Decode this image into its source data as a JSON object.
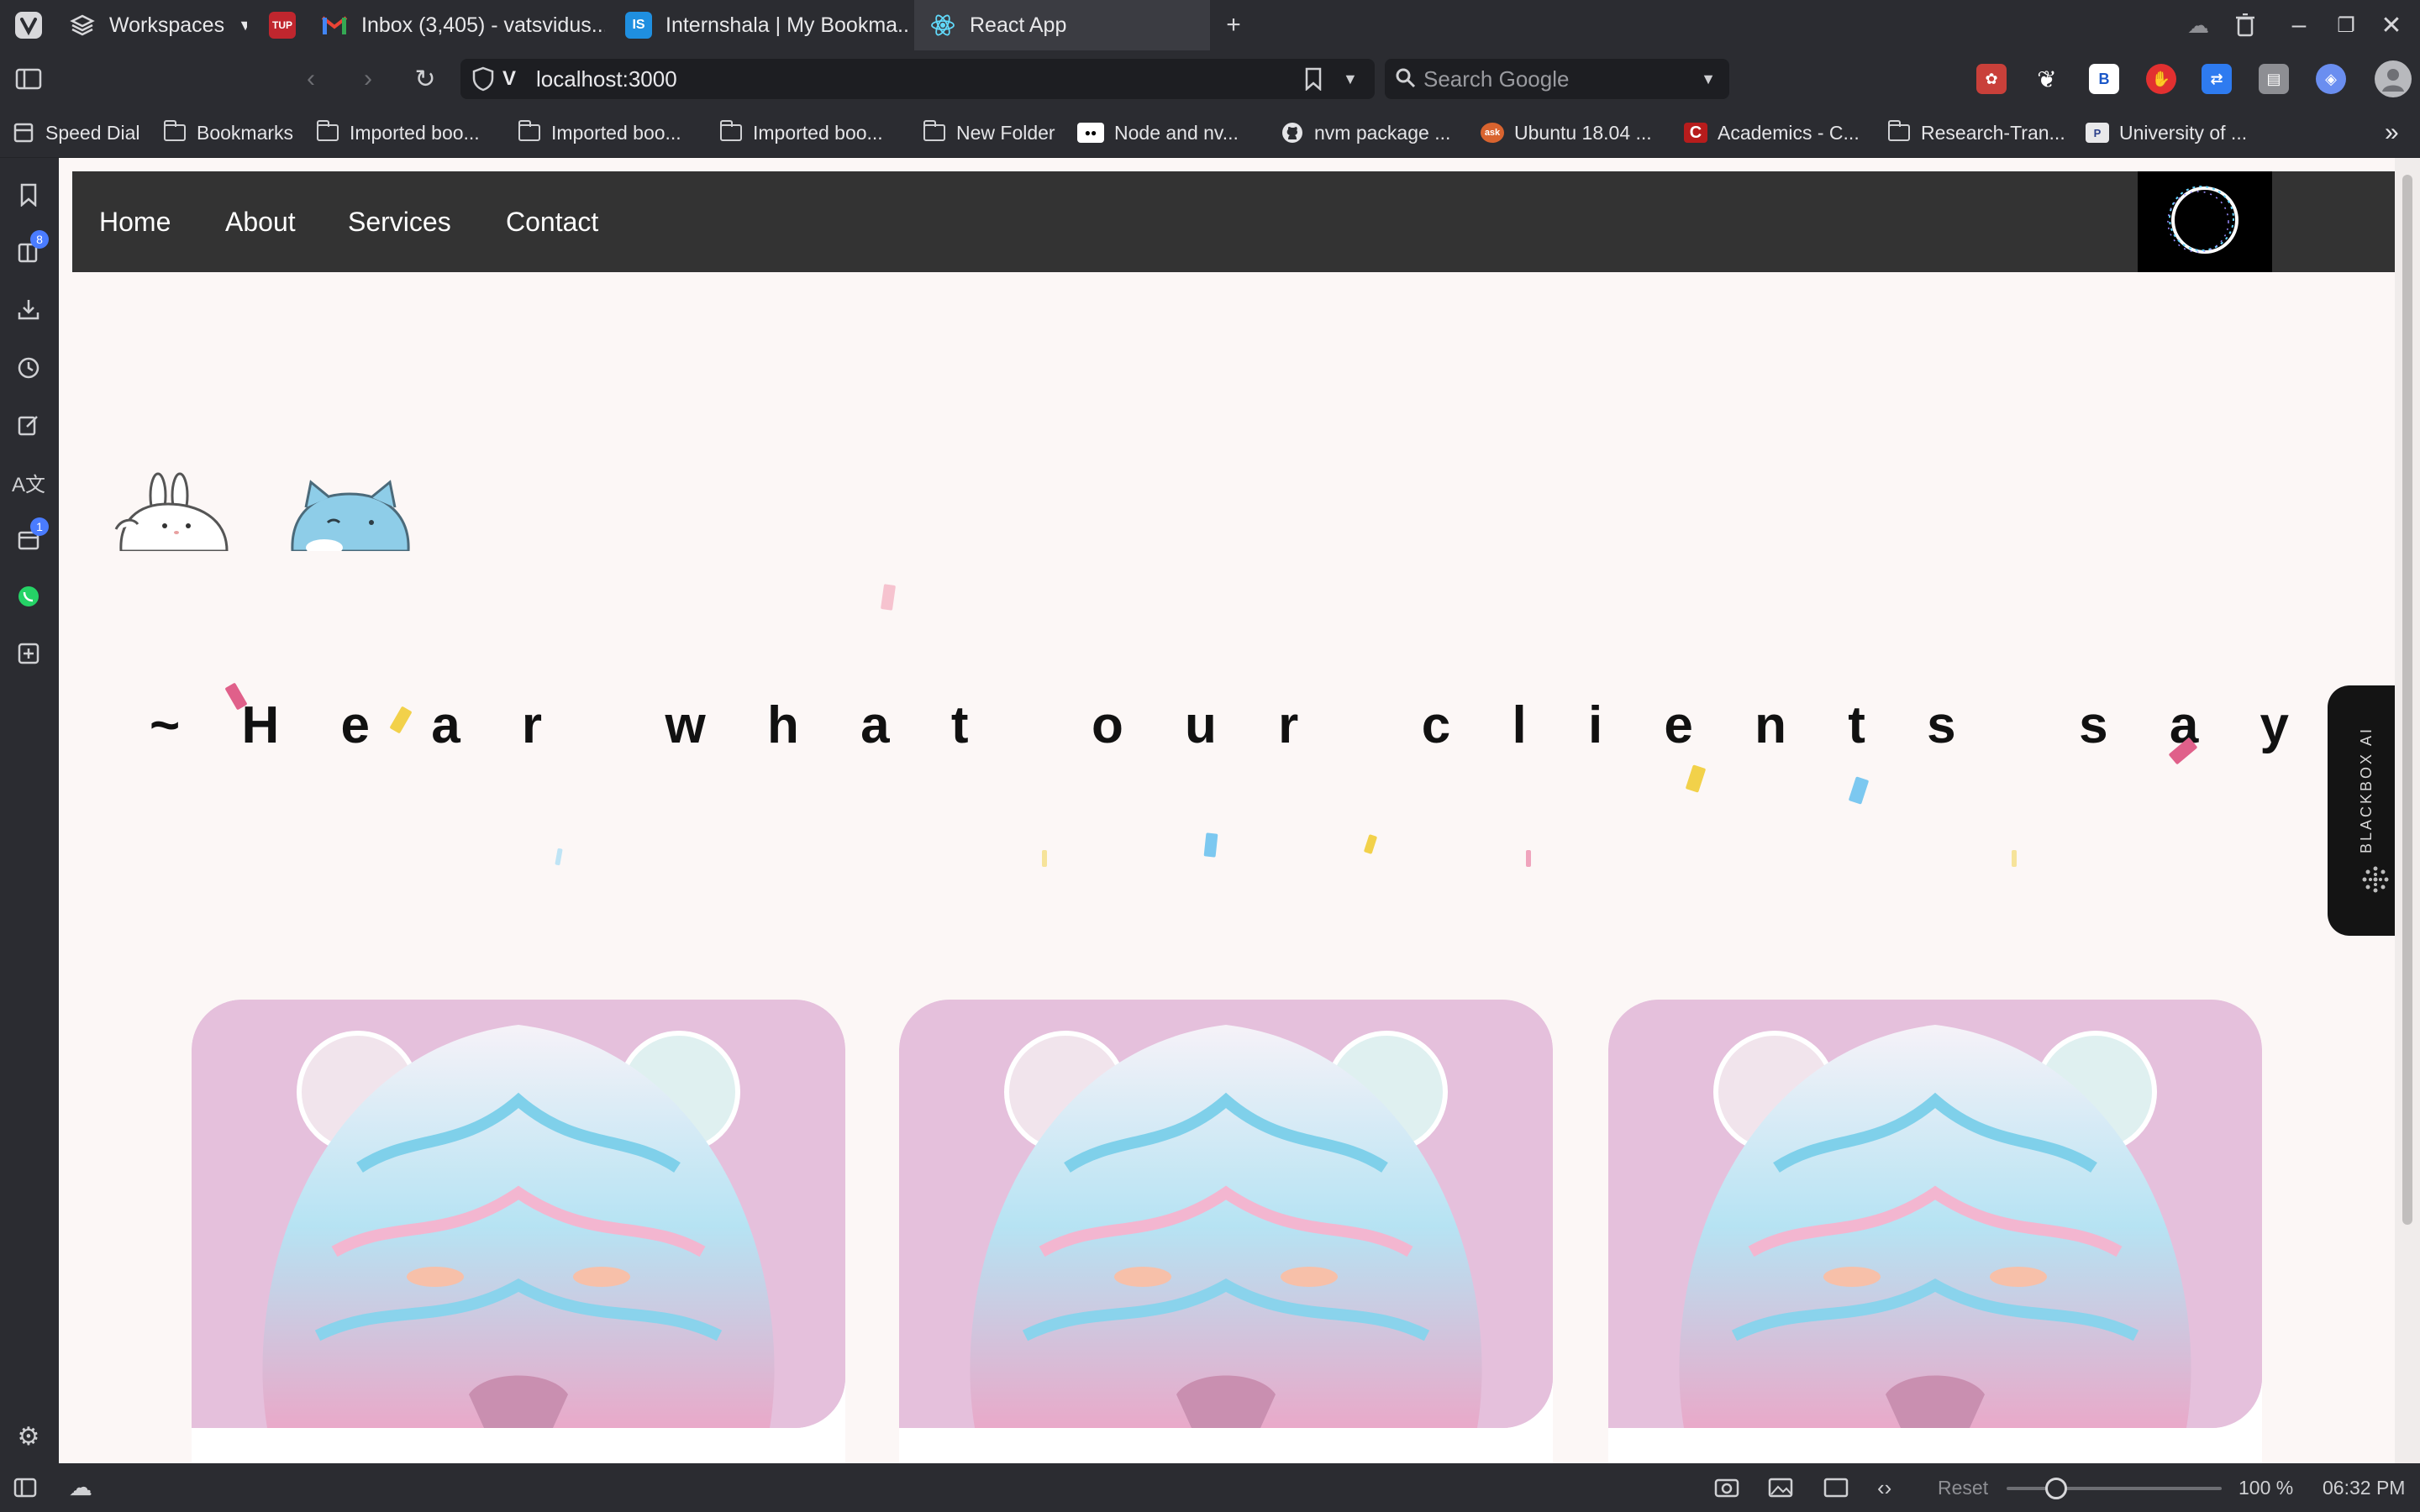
{
  "browser": {
    "workspaces_label": "Workspaces",
    "tabs": [
      {
        "label": "Inbox (3,405) - vatsvidus..."
      },
      {
        "label": "Internshala | My Bookma..."
      },
      {
        "label": "React App"
      }
    ],
    "url": "localhost:3000",
    "search_placeholder": "Search Google",
    "bookmarks": [
      {
        "label": "Speed Dial"
      },
      {
        "label": "Bookmarks"
      },
      {
        "label": "Imported boo..."
      },
      {
        "label": "Imported boo..."
      },
      {
        "label": "Imported boo..."
      },
      {
        "label": "New Folder"
      },
      {
        "label": "Node and nv..."
      },
      {
        "label": "nvm package ..."
      },
      {
        "label": "Ubuntu 18.04 ..."
      },
      {
        "label": "Academics - C..."
      },
      {
        "label": "Research-Tran..."
      },
      {
        "label": "University of ..."
      }
    ],
    "side_badges": {
      "tabs": "8",
      "calendar": "1"
    },
    "status": {
      "reset_label": "Reset",
      "zoom": "100 %",
      "time": "06:32 PM",
      "zoom_level": 0.2
    }
  },
  "site": {
    "nav": [
      {
        "label": "Home"
      },
      {
        "label": "About"
      },
      {
        "label": "Services"
      },
      {
        "label": "Contact"
      }
    ],
    "heading_chars": [
      "~",
      "H",
      "e",
      "a",
      "r",
      "",
      "w",
      "h",
      "a",
      "t",
      "",
      "o",
      "u",
      "r",
      "",
      "c",
      "l",
      "i",
      "e",
      "n",
      "t",
      "s",
      "",
      "s",
      "a",
      "y",
      "!"
    ],
    "blackbox_label": "BLACKBOX AI"
  },
  "colors": {
    "nav_bg": "#333333",
    "page_bg": "#fcf7f6",
    "card_bg": "#e5c0dc",
    "confetti_pink": "#e0608a",
    "confetti_yellow": "#f2d14a",
    "confetti_blue": "#7cc8f0"
  }
}
